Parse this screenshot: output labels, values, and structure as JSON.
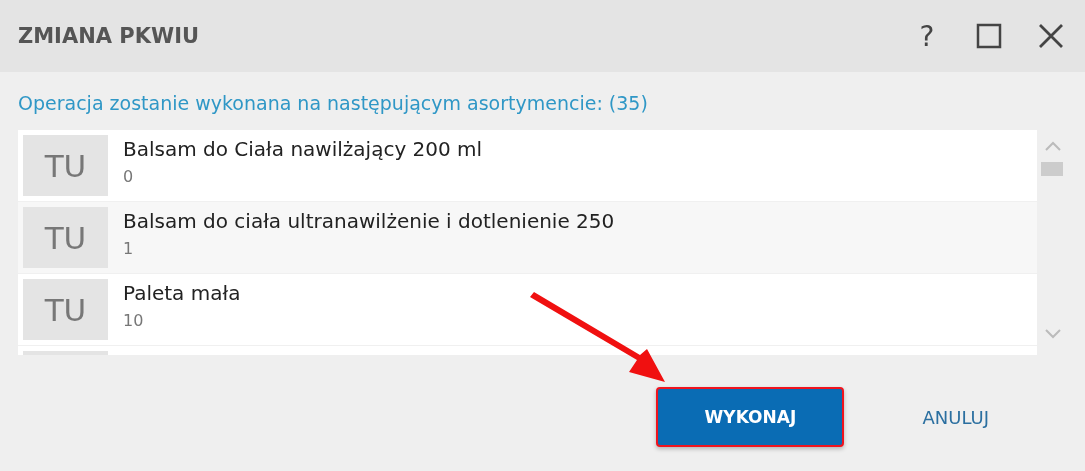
{
  "window": {
    "title": "ZMIANA PKWIU",
    "controls": [
      {
        "kind": "help",
        "label": "?"
      },
      {
        "kind": "maximize"
      },
      {
        "kind": "close"
      }
    ]
  },
  "heading": "Operacja zostanie wykonana na następującym asortymencie: (35)",
  "items": [
    {
      "badge": "TU",
      "name": "Balsam do Ciała nawilżający 200 ml",
      "code": "0"
    },
    {
      "badge": "TU",
      "name": "Balsam do ciała ultranawilżenie i dotlenienie 250",
      "code": "1"
    },
    {
      "badge": "TU",
      "name": "Paleta mała",
      "code": "10"
    }
  ],
  "buttons": [
    {
      "kind": "primary",
      "label": "WYKONAJ",
      "highlighted": true
    },
    {
      "kind": "link",
      "label": "ANULUJ",
      "highlighted": false
    }
  ]
}
